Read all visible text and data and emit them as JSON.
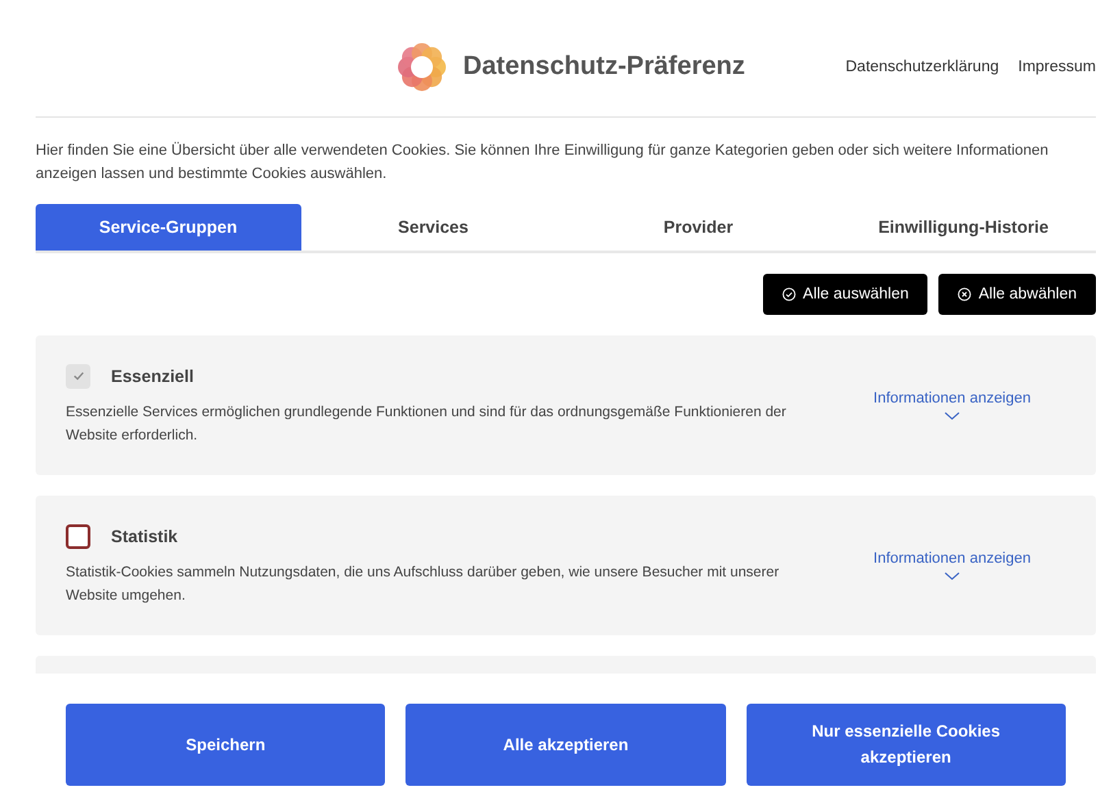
{
  "header": {
    "title": "Datenschutz-Präferenz",
    "links": [
      "Datenschutzerklärung",
      "Impressum"
    ]
  },
  "intro": "Hier finden Sie eine Übersicht über alle verwendeten Cookies. Sie können Ihre Einwilligung für ganze Kategorien geben oder sich weitere Informationen anzeigen lassen und bestimmte Cookies auswählen.",
  "tabs": [
    {
      "label": "Service-Gruppen",
      "selected": true
    },
    {
      "label": "Services",
      "selected": false
    },
    {
      "label": "Provider",
      "selected": false
    },
    {
      "label": "Einwilligung-Historie",
      "selected": false
    }
  ],
  "bulk_actions": [
    {
      "label": "Alle auswählen",
      "kind": "select"
    },
    {
      "label": "Alle abwählen",
      "kind": "deselect"
    }
  ],
  "groups": [
    {
      "name": "Essenziell",
      "checked": true,
      "disabled": true,
      "description": "Essenzielle Services ermöglichen grundlegende Funktionen und sind für das ordnungsgemäße Funktionieren der Website erforderlich.",
      "info_link": "Informationen anzeigen"
    },
    {
      "name": "Statistik",
      "checked": false,
      "disabled": false,
      "description": "Statistik-Cookies sammeln Nutzungsdaten, die uns Aufschluss darüber geben, wie unsere Besucher mit unserer Website umgehen.",
      "info_link": "Informationen anzeigen"
    }
  ],
  "footer_buttons": [
    "Speichern",
    "Alle akzeptieren",
    "Nur essenzielle Cookies akzeptieren"
  ]
}
